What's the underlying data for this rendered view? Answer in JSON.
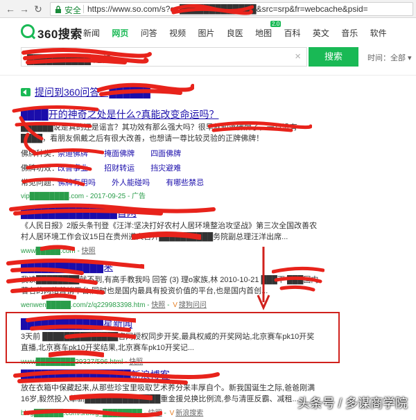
{
  "browser": {
    "secure_label": "安全",
    "url": "https://www.so.com/s?q=█████████████&src=srp&fr=webcache&psid="
  },
  "header": {
    "logo_text": "360搜索",
    "tabs": [
      "新闻",
      "网页",
      "问答",
      "视频",
      "图片",
      "良医",
      "地图",
      "百科",
      "英文",
      "音乐",
      "软件"
    ],
    "active_tab": "网页",
    "badge": "2.0"
  },
  "search": {
    "query": "██████████ 运势",
    "button_label": "搜索",
    "time_filter": "时间：全部 ▾",
    "clear_icon": "×"
  },
  "results": [
    {
      "title": "提问到360问答：██████",
      "type": "ask"
    },
    {
      "title": "████开的神奇之处是什么?真能改变命运吗？",
      "desc": "██████说是真的还是谣言？其功效有那么强大吗？很早就知道佛牌了，一直没有████，看朋友佩戴之后有很大改善，也想请一尊比较灵验的正牌佛牌！",
      "rows": [
        {
          "key": "佛牌种类：",
          "vals": [
            "崇迪佛牌",
            "掩面佛牌",
            "四面佛牌"
          ]
        },
        {
          "key": "佛牌功效：",
          "vals": [
            "改善事业",
            "招财转运",
            "挡灾避难"
          ]
        },
        {
          "key": "常见问题：",
          "vals": [
            "佛牌有用吗",
            "外人能碰吗",
            "有哪些禁忌"
          ]
        }
      ],
      "url": "vip████████.com - 2017-09-25 - 广告"
    },
    {
      "title": "██████████████首网",
      "desc": "《人民日报》2版头条刊登《汪洋:坚决打好农村人居环境整治攻坚战》第三次全国改善农村人居环境工作会议15日在贵州遵义召开██████████务院副总理汪洋出席...",
      "url": "www█████.com",
      "snapshot": "快照"
    },
    {
      "title": "████████████来",
      "desc": "我读████████就不到,有高手教我吗 回答 (3) 理o家族,林 2010-10-21 ███下 ███国内著名的网络营销平台,同时也是国内最具有投资价值的平台,也是国内首创...",
      "url": "wenwen█████.com/z/q229983398.htm",
      "snapshot": "快照",
      "extra_link": "搜狗问问"
    },
    {
      "title": "████████████星新闻",
      "desc": "3天前 ██████████████官网授权同步开奖,最具权威的开奖网站,北京赛车pk10开奖直播,北京赛车pk10开奖结果,北京赛车pk10开奖记...",
      "url": "www████████29327/596.html",
      "snapshot": "快照"
    },
    {
      "title": "████████████████新浪博客",
      "desc": "放在衣箱中保藏起来,从那些珍宝里吸取艺术养分来丰厚自个。新我国诞生之际,爸爸刚满16岁,毅然投入革新██████████████重金援兑换比例流,参与清匪反霸、减租...",
      "url": "blog██████.com/s/blog_████████",
      "snapshot": "快照",
      "extra_link": "新浪搜索"
    }
  ],
  "watermark": "头条号 / 多谋商学院",
  "colors": {
    "brand_green": "#19b955",
    "link_blue": "#1a0dab",
    "url_green": "#2a9d4a",
    "highlight_red": "#d0211c",
    "redaction_red": "#e8231b"
  }
}
